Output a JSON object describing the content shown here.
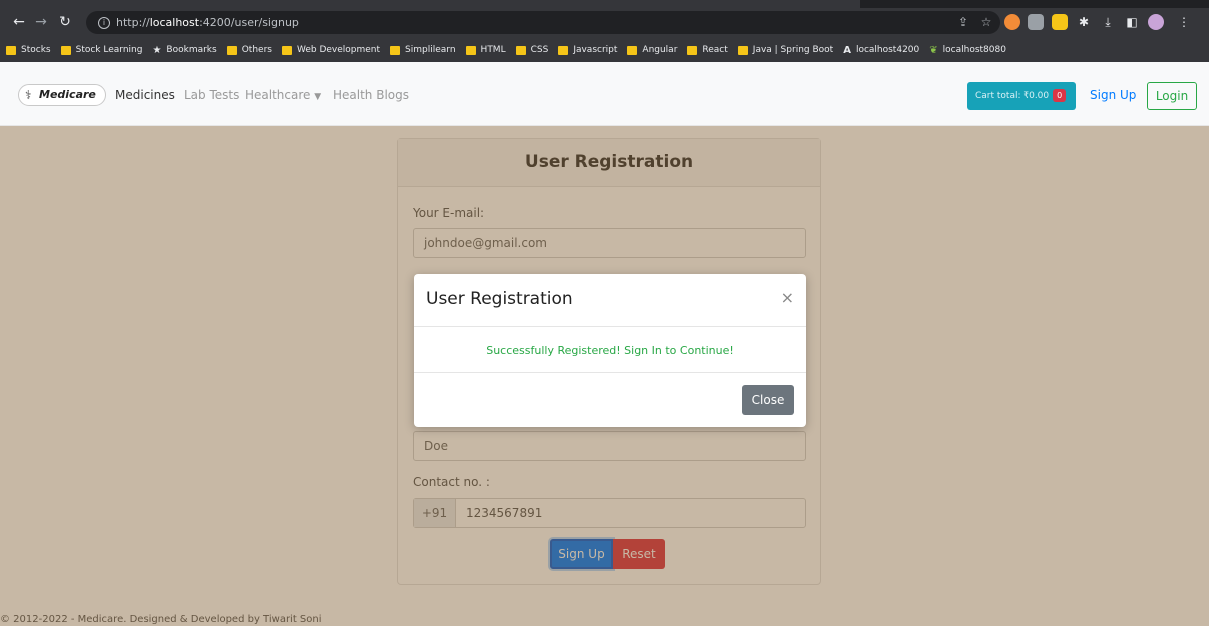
{
  "browser": {
    "url_scheme": "http://",
    "url_host": "localhost",
    "url_rest": ":4200/user/signup",
    "bookmarks": [
      {
        "label": "Stocks",
        "icon": "folder-icon"
      },
      {
        "label": "Stock Learning",
        "icon": "folder-icon"
      },
      {
        "label": "Bookmarks",
        "icon": "star-icon"
      },
      {
        "label": "Others",
        "icon": "folder-icon"
      },
      {
        "label": "Web Development",
        "icon": "folder-icon"
      },
      {
        "label": "Simplilearn",
        "icon": "folder-icon"
      },
      {
        "label": "HTML",
        "icon": "folder-icon"
      },
      {
        "label": "CSS",
        "icon": "folder-icon"
      },
      {
        "label": "Javascript",
        "icon": "folder-icon"
      },
      {
        "label": "Angular",
        "icon": "folder-icon"
      },
      {
        "label": "React",
        "icon": "folder-icon"
      },
      {
        "label": "Java | Spring Boot",
        "icon": "folder-icon"
      },
      {
        "label": "localhost4200",
        "icon": "angular-icon"
      },
      {
        "label": "localhost8080",
        "icon": "leaf-icon"
      }
    ]
  },
  "navbar": {
    "brand": "Medicare",
    "links": [
      "Medicines",
      "Lab Tests",
      "Healthcare",
      "Health Blogs"
    ],
    "cart_label": "Cart total: ₹0.00",
    "cart_count": "0",
    "signup": "Sign Up",
    "login": "Login"
  },
  "form": {
    "title": "User Registration",
    "email_label": "Your E-mail:",
    "email_value": "johndoe@gmail.com",
    "lastname_value": "Doe",
    "contact_label": "Contact no. :",
    "phone_prefix": "+91",
    "phone_value": "1234567891",
    "signup_button": "Sign Up",
    "reset_button": "Reset"
  },
  "footer": "© 2012-2022 - Medicare. Designed & Developed by Tiwarit Soni",
  "modal": {
    "title": "User Registration",
    "close_x": "×",
    "message": "Successfully Registered! Sign In to Continue!",
    "close_button": "Close"
  },
  "colors": {
    "backdrop": "#7a5628",
    "success": "#28a745",
    "primary": "#007bff",
    "danger": "#dc3545",
    "info": "#17a2b8"
  }
}
